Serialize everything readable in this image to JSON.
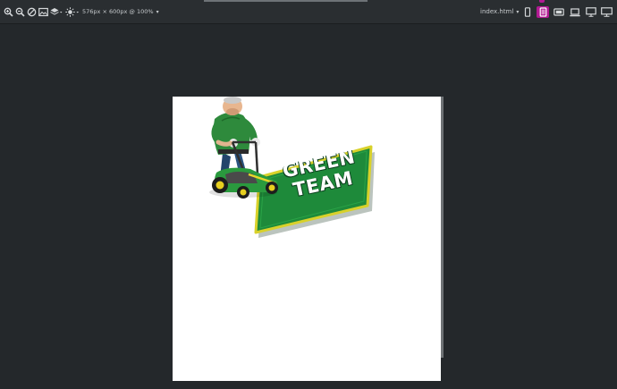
{
  "toolbar": {
    "icons": [
      "zoom-in-icon",
      "zoom-out-icon",
      "disable-icon",
      "image-icon",
      "layers-icon",
      "brightness-icon"
    ],
    "size_readout": "576px × 600px @ 100%",
    "file_select": "index.html",
    "devices": [
      "phone-portrait-icon",
      "tablet-icon",
      "tablet-landscape-icon",
      "laptop-icon",
      "desktop-icon",
      "wide-desktop-icon"
    ],
    "active_device": "tablet-icon",
    "active_color": "#b21a93"
  },
  "preview": {
    "background": "#ffffff",
    "logo": {
      "line1": "GREEN",
      "line2": "TEAM",
      "sign_color": "#1e8a3a",
      "border_color": "#d8d12a"
    }
  }
}
